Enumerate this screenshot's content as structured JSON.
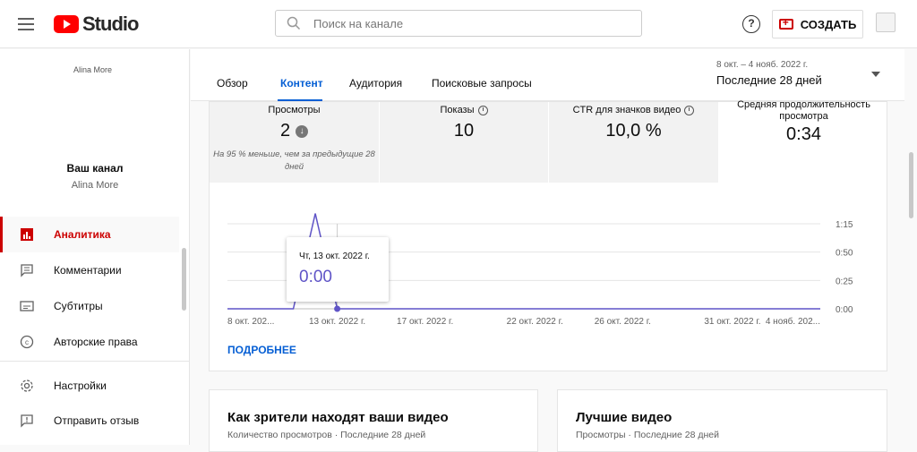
{
  "header": {
    "logo_text": "Studio",
    "search_placeholder": "Поиск на канале",
    "help_label": "?",
    "create_label": "СОЗДАТЬ"
  },
  "sidebar": {
    "channel_image_alt": "Alina More",
    "channel_title": "Ваш канал",
    "channel_name": "Alina More",
    "items": [
      {
        "label": "Аналитика",
        "icon": "analytics-icon",
        "active": true
      },
      {
        "label": "Комментарии",
        "icon": "comments-icon"
      },
      {
        "label": "Субтитры",
        "icon": "subtitles-icon"
      },
      {
        "label": "Авторские права",
        "icon": "copyright-icon"
      },
      {
        "label": "Настройки",
        "icon": "gear-icon"
      },
      {
        "label": "Отправить отзыв",
        "icon": "feedback-icon"
      }
    ]
  },
  "tabs": [
    {
      "label": "Обзор"
    },
    {
      "label": "Контент",
      "active": true
    },
    {
      "label": "Аудитория"
    },
    {
      "label": "Поисковые запросы"
    }
  ],
  "period": {
    "range": "8 окт. – 4 нояб. 2022 г.",
    "label": "Последние 28 дней"
  },
  "metrics": [
    {
      "title": "Просмотры",
      "value": "2",
      "note": "На 95 % меньше, чем за предыдущие 28 дней"
    },
    {
      "title": "Показы",
      "value": "10"
    },
    {
      "title": "CTR для значков видео",
      "value": "10,0 %"
    },
    {
      "title": "Средняя продолжительность просмотра",
      "value": "0:34"
    }
  ],
  "chart_data": {
    "type": "line",
    "x": [
      "8 окт. 2022",
      "9 окт. 2022",
      "10 окт. 2022",
      "11 окт. 2022",
      "12 окт. 2022",
      "13 окт. 2022",
      "14 окт. 2022",
      "15 окт. 2022",
      "16 окт. 2022",
      "17 окт. 2022 г.",
      "18 окт. 2022",
      "19 окт. 2022",
      "20 окт. 2022",
      "21 окт. 2022",
      "22 окт. 2022 г.",
      "23 окт. 2022",
      "24 окт. 2022",
      "25 окт. 2022",
      "26 окт. 2022 г.",
      "27 окт. 2022",
      "28 окт. 2022",
      "29 окт. 2022",
      "30 окт. 2022",
      "31 окт. 2022 г.",
      "1 нояб. 2022",
      "2 нояб. 2022",
      "3 нояб. 2022",
      "4 нояб. 2022"
    ],
    "series": [
      {
        "values": [
          0,
          0,
          0,
          0,
          1.4,
          0,
          0,
          0,
          0,
          0,
          0,
          0,
          0,
          0,
          0,
          0,
          0,
          0,
          0,
          0,
          0,
          0,
          0,
          0,
          0,
          0,
          0,
          0
        ]
      }
    ],
    "x_tick_labels": [
      "8 окт. 202...",
      "13 окт. 2022 г.",
      "17 окт. 2022 г.",
      "22 окт. 2022 г.",
      "26 окт. 2022 г.",
      "31 окт. 2022 г.",
      "4 нояб. 202..."
    ],
    "y_tick_labels": [
      "1:15",
      "0:50",
      "0:25",
      "0:00"
    ],
    "ylim": [
      0,
      1.25
    ],
    "color": "#5f54c7",
    "tooltip": {
      "date": "Чт, 13 окт. 2022 г.",
      "value": "0:00"
    }
  },
  "more_link": "ПОДРОБНЕЕ",
  "bottom_cards": [
    {
      "title": "Как зрители находят ваши видео",
      "subtitle": "Количество просмотров · Последние 28 дней"
    },
    {
      "title": "Лучшие видео",
      "subtitle": "Просмотры · Последние 28 дней"
    }
  ]
}
